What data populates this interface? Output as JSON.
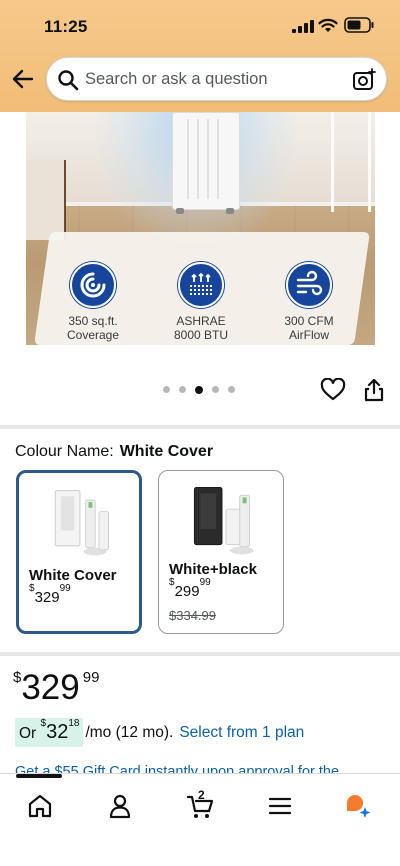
{
  "status_bar": {
    "time": "11:25"
  },
  "header": {
    "search_placeholder": "Search or ask a question"
  },
  "features": [
    {
      "label": "350 sq.ft. Coverage",
      "line1": "350 sq.ft.",
      "line2": "Coverage",
      "icon": "coverage-icon"
    },
    {
      "label": "ASHRAE 8000 BTU",
      "line1": "ASHRAE",
      "line2": "8000 BTU",
      "icon": "cooling-icon"
    },
    {
      "label": "300 CFM AirFlow",
      "line1": "300 CFM",
      "line2": "AirFlow",
      "icon": "airflow-icon"
    }
  ],
  "carousel": {
    "count": 5,
    "active_index": 2
  },
  "colour": {
    "label": "Colour Name:",
    "selected": "White Cover",
    "options": [
      {
        "name": "White Cover",
        "price_whole": "329",
        "price_fraction": "99",
        "was_price": ""
      },
      {
        "name": "White+black",
        "price_whole": "299",
        "price_fraction": "99",
        "was_price": "$334.99"
      }
    ]
  },
  "price": {
    "currency": "$",
    "whole": "329",
    "fraction": "99"
  },
  "monthly": {
    "prefix": "Or ",
    "currency": "$",
    "whole": "32",
    "fraction": "18",
    "suffix": "/mo (12 mo).",
    "link": "Select from 1 plan"
  },
  "gift_card_line": "Get a $55 Gift Card instantly upon approval for the",
  "bottom_nav": {
    "items": [
      "home",
      "account",
      "cart",
      "menu",
      "rufus"
    ],
    "cart_count": "2"
  },
  "colors": {
    "header_bg": "#f3c27f",
    "link": "#0d5fa6",
    "selected_border": "#2a5a8a",
    "feature_icon_bg": "#16459b",
    "emi_highlight": "#d7f3e9"
  }
}
